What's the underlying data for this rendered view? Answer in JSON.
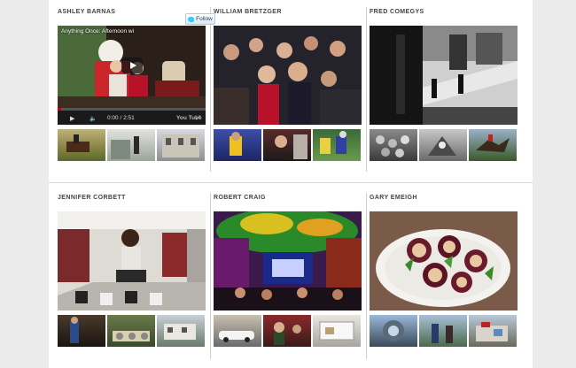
{
  "photographers": [
    {
      "name": "ASHLEY BARNAS",
      "follow_label": "Follow",
      "video": {
        "title": "Anything Once: Afternoon wi",
        "time": "0:00 / 2:51",
        "brand": "You Tube"
      }
    },
    {
      "name": "WILLIAM BRETZGER"
    },
    {
      "name": "FRED COMEGYS"
    },
    {
      "name": "JENNIFER CORBETT"
    },
    {
      "name": "ROBERT CRAIG"
    },
    {
      "name": "GARY EMEIGH"
    }
  ]
}
